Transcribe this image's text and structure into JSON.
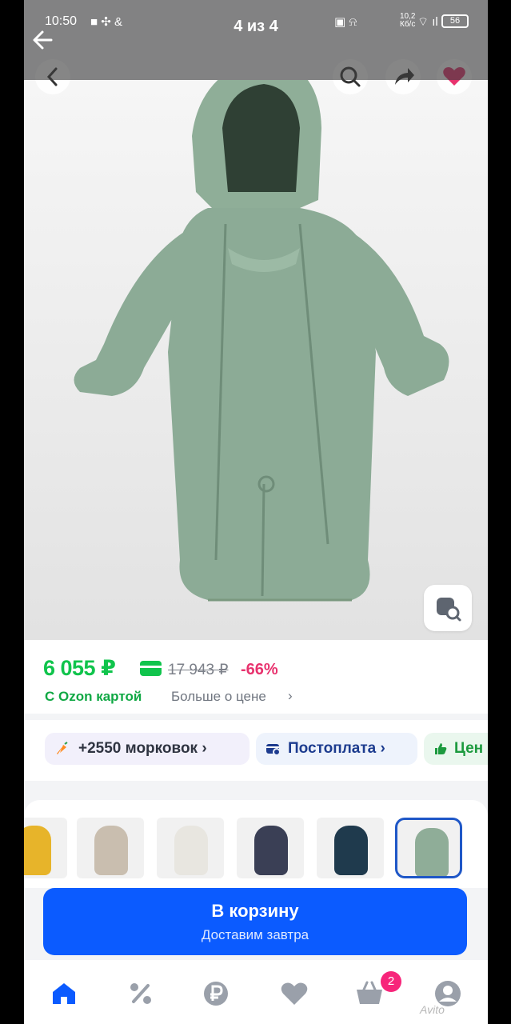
{
  "status_bar": {
    "time": "10:50",
    "net_speed": "10,2\nКб/с",
    "battery": "56"
  },
  "viewer": {
    "counter": "4 из 4"
  },
  "price": {
    "current": "6 055 ₽",
    "old": "17 943 ₽",
    "discount": "-66%",
    "ozon_card": "С Ozon картой",
    "more": "Больше о цене",
    "colors": {
      "green": "#10c44c",
      "pink": "#e8326e"
    }
  },
  "chips": [
    {
      "label": "+2550 морковок",
      "icon": "carrot-icon"
    },
    {
      "label": "Постоплата",
      "icon": "postpay-icon"
    },
    {
      "label": "Цен",
      "icon": "thumbs-up-icon"
    }
  ],
  "variants": [
    {
      "color": "#e7b42a"
    },
    {
      "color": "#c9beaf"
    },
    {
      "color": "#e8e6e0"
    },
    {
      "color": "#3a3f55"
    },
    {
      "color": "#1f3a4d"
    },
    {
      "color": "#8fad98",
      "selected": true
    }
  ],
  "cart": {
    "title": "В корзину",
    "subtitle": "Доставим завтра",
    "color": "#0b5bff"
  },
  "nav": {
    "items": [
      "home-icon",
      "percent-icon",
      "ruble-icon",
      "heart-icon",
      "basket-icon",
      "profile-icon"
    ],
    "cart_badge": "2"
  },
  "watermark": "Avito"
}
